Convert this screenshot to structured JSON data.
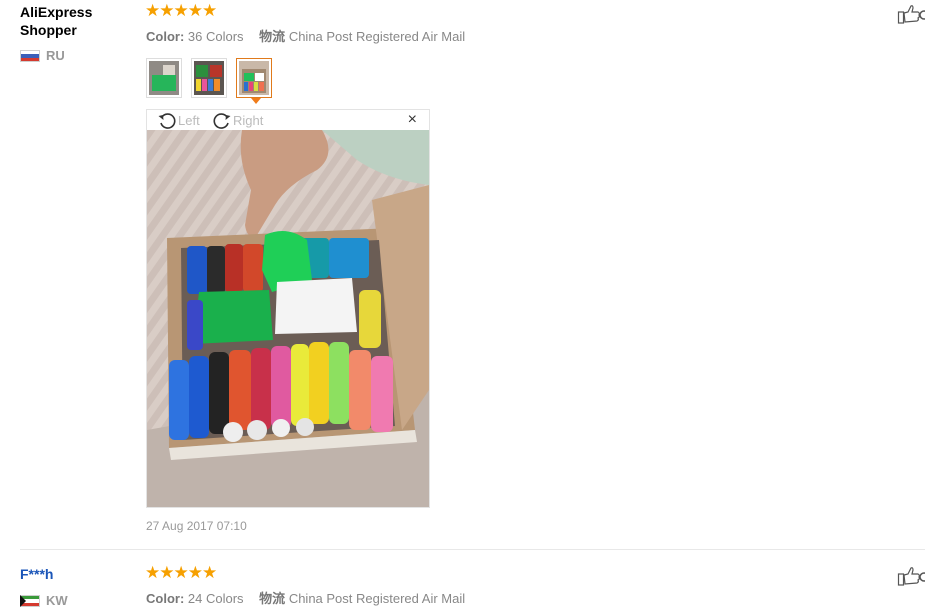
{
  "reviews": [
    {
      "user": "AliExpress Shopper",
      "country": "RU",
      "rating": "★★★★★",
      "color_label": "Color:",
      "color_value": "36 Colors",
      "shipping_label": "物流",
      "shipping_value": "China Post Registered Air Mail",
      "viewer": {
        "left_label": "Left",
        "right_label": "Right",
        "close_label": "×"
      },
      "date": "27 Aug 2017 07:10"
    },
    {
      "user": "F***h",
      "country": "KW",
      "rating": "★★★★★",
      "color_label": "Color:",
      "color_value": "24 Colors",
      "shipping_label": "物流",
      "shipping_value": "China Post Registered Air Mail"
    }
  ],
  "colors": {
    "star": "#f6a000",
    "user_link": "#1a55b8",
    "active_thumb": "#e07a1b"
  },
  "icons": [
    "thumbs-up-icon",
    "rotate-left-icon",
    "rotate-right-icon",
    "close-icon"
  ]
}
